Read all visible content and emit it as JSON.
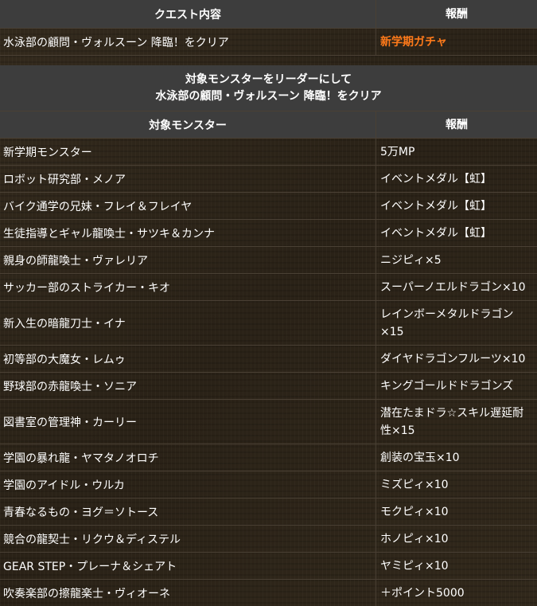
{
  "quest_table": {
    "header_quest": "クエスト内容",
    "header_reward": "報酬",
    "quest": "水泳部の顧問・ヴォルスーン 降臨！をクリア",
    "reward": "新学期ガチャ",
    "reward_color": "#ff7a1a"
  },
  "leader_table": {
    "title_line1": "対象モンスターをリーダーにして",
    "title_line2": "水泳部の顧問・ヴォルスーン 降臨！をクリア",
    "header_monster": "対象モンスター",
    "header_reward": "報酬",
    "rows": [
      {
        "monster": "新学期モンスター",
        "reward": "5万MP"
      },
      {
        "monster": "ロボット研究部・メノア",
        "reward": "イベントメダル【虹】"
      },
      {
        "monster": "バイク通学の兄妹・フレイ＆フレイヤ",
        "reward": "イベントメダル【虹】"
      },
      {
        "monster": "生徒指導とギャル龍喚士・サツキ＆カンナ",
        "reward": "イベントメダル【虹】"
      },
      {
        "monster": "親身の師龍喚士・ヴァレリア",
        "reward": "ニジピィ×5"
      },
      {
        "monster": "サッカー部のストライカー・キオ",
        "reward": "スーパーノエルドラゴン×10"
      },
      {
        "monster": "新入生の暗龍刀士・イナ",
        "reward": "レインボーメタルドラゴン×15"
      },
      {
        "monster": "初等部の大魔女・レムゥ",
        "reward": "ダイヤドラゴンフルーツ×10"
      },
      {
        "monster": "野球部の赤龍喚士・ソニア",
        "reward": "キングゴールドドラゴンズ"
      },
      {
        "monster": "図書室の管理神・カーリー",
        "reward": "潜在たまドラ☆スキル遅延耐性×15"
      },
      {
        "monster": "学園の暴れ龍・ヤマタノオロチ",
        "reward": "創装の宝玉×10"
      },
      {
        "monster": "学園のアイドル・ウルカ",
        "reward": "ミズピィ×10"
      },
      {
        "monster": "青春なるもの・ヨグ＝ソトース",
        "reward": "モクピィ×10"
      },
      {
        "monster": "競合の龍契士・リクウ＆ディステル",
        "reward": "ホノピィ×10"
      },
      {
        "monster": "GEAR STEP・プレーナ＆シェアト",
        "reward": "ヤミピィ×10"
      },
      {
        "monster": "吹奏楽部の擦龍楽士・ヴィオーネ",
        "reward": "＋ポイント5000"
      }
    ]
  }
}
